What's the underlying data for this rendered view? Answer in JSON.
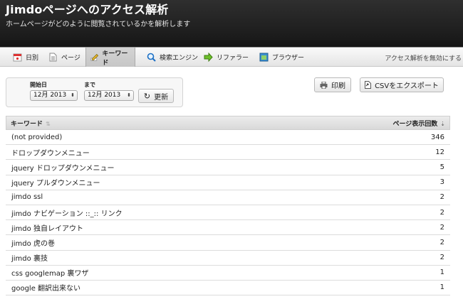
{
  "header": {
    "title": "Jimdoページへのアクセス解析",
    "subtitle": "ホームページがどのように閲覧されているかを解析します"
  },
  "tabs": [
    {
      "label": "日別",
      "icon": "calendar-icon",
      "active": false
    },
    {
      "label": "ページ",
      "icon": "page-icon",
      "active": false
    },
    {
      "label": "キーワード",
      "icon": "pencil-icon",
      "active": true
    },
    {
      "label": "検索エンジン",
      "icon": "magnifier-icon",
      "active": false
    },
    {
      "label": "リファラー",
      "icon": "arrow-right-icon",
      "active": false
    },
    {
      "label": "ブラウザー",
      "icon": "window-icon",
      "active": false
    }
  ],
  "disable_link": "アクセス解析を無効にする",
  "filter": {
    "start_label": "開始日",
    "end_label": "まで",
    "start_value": "12月 2013",
    "end_value": "12月 2013",
    "refresh_label": "更新"
  },
  "actions": {
    "print_label": "印刷",
    "csv_label": "CSVをエクスポート"
  },
  "table": {
    "col_keyword": "キーワード",
    "col_count": "ページ表示回数",
    "rows": [
      {
        "keyword": "(not provided)",
        "count": "346"
      },
      {
        "keyword": "ドロップダウンメニュー",
        "count": "12"
      },
      {
        "keyword": "jquery ドロップダウンメニュー",
        "count": "5"
      },
      {
        "keyword": "jquery プルダウンメニュー",
        "count": "3"
      },
      {
        "keyword": "jimdo ssl",
        "count": "2"
      },
      {
        "keyword": "jimdo ナビゲーション ::_:: リンク",
        "count": "2"
      },
      {
        "keyword": "jimdo 独自レイアウト",
        "count": "2"
      },
      {
        "keyword": "jimdo 虎の巻",
        "count": "2"
      },
      {
        "keyword": "jimdo 裏技",
        "count": "2"
      },
      {
        "keyword": "css googlemap 裏ワザ",
        "count": "1"
      },
      {
        "keyword": "google 翻訳出来ない",
        "count": "1"
      }
    ]
  }
}
